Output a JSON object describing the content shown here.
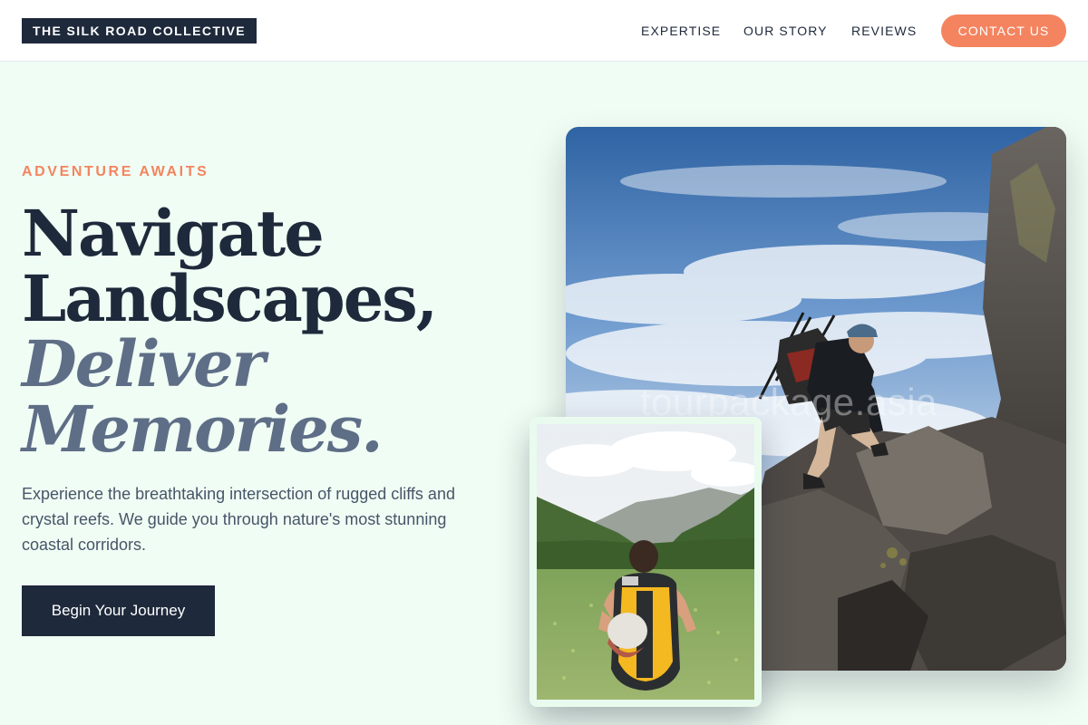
{
  "header": {
    "logo": "THE SILK ROAD COLLECTIVE",
    "nav": [
      "EXPERTISE",
      "OUR STORY",
      "REVIEWS"
    ],
    "contact_label": "CONTACT US"
  },
  "hero": {
    "eyebrow": "ADVENTURE AWAITS",
    "headline_line1": "Navigate",
    "headline_line2": "Landscapes,",
    "headline_line3": "Deliver",
    "headline_line4": "Memories.",
    "description": "Experience the breathtaking intersection of rugged cliffs and crystal reefs. We guide you through nature's most stunning coastal corridors.",
    "cta_label": "Begin Your Journey"
  },
  "images": {
    "main_watermark": "tourpackage.asia"
  },
  "colors": {
    "page_bg": "#f0fdf4",
    "navy": "#1e293b",
    "accent": "#f4845f",
    "muted_blue": "#5f6e87"
  }
}
